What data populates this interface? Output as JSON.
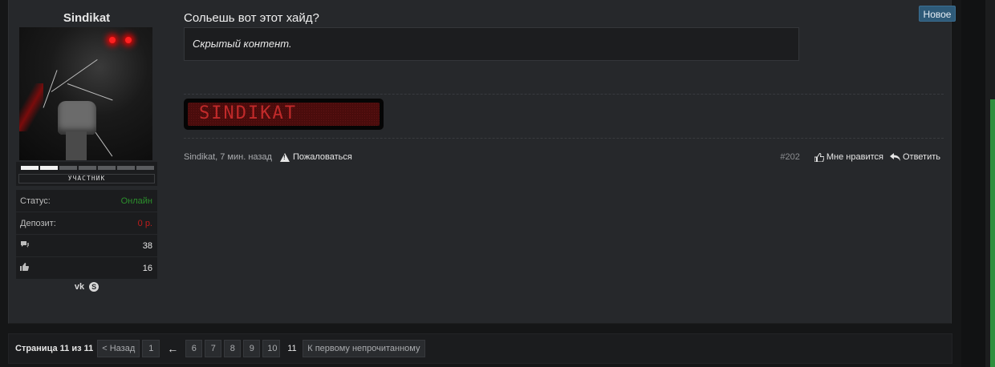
{
  "badge": {
    "new": "Новое"
  },
  "user": {
    "name": "Sindikat",
    "rank_title": "УЧАСТНИК",
    "rank_level": 2,
    "rank_total": 7,
    "stats": [
      {
        "label": "Статус:",
        "value": "Онлайн",
        "tone": "green"
      },
      {
        "label": "Депозит:",
        "value": "0 р.",
        "tone": "red"
      },
      {
        "icon": "messages-icon",
        "value": "38"
      },
      {
        "icon": "like-icon",
        "value": "16"
      }
    ],
    "social": {
      "vk": "vk-icon",
      "skype": "skype-icon"
    }
  },
  "post": {
    "title": "Сольешь вот этот хайд?",
    "hidden_text": "Скрытый контент.",
    "signature": "SINDIKAT",
    "author_time": "Sindikat, 7 мин. назад",
    "report": "Пожаловаться",
    "number": "#202",
    "like": "Мне нравится",
    "reply": "Ответить"
  },
  "pagination": {
    "label": "Страница 11 из 11",
    "prev": "< Назад",
    "first": "1",
    "arrow": "←",
    "pages": [
      "6",
      "7",
      "8",
      "9",
      "10",
      "11"
    ],
    "current": "11",
    "first_unread": "К первому непрочитанному"
  }
}
